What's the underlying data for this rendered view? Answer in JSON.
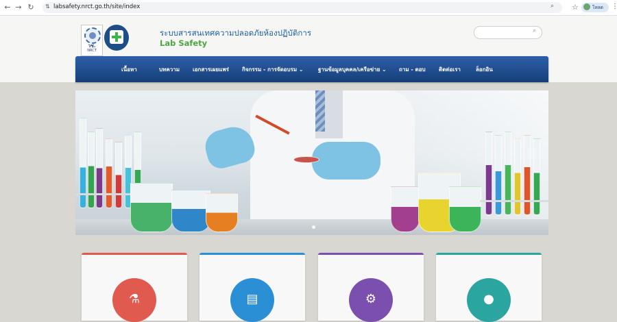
{
  "browser": {
    "url": "labsafety.nrct.go.th/site/index",
    "profile_label": "โหลด"
  },
  "header": {
    "title": "ระบบสารสนเทศความปลอดภัยห้องปฏิบัติการ",
    "subtitle": "Lab Safety",
    "logo1_text": "วช.",
    "logo1_sub": "NRCT"
  },
  "nav": {
    "items": [
      {
        "label": "เนื้อหา"
      },
      {
        "label": "บทความ"
      },
      {
        "label": "เอกสารเผยแพร่"
      },
      {
        "label": "กิจกรรม - การจัดอบรม ⌄"
      },
      {
        "label": "ฐานข้อมูลบุคคล/เครือข่าย ⌄"
      },
      {
        "label": "ถาม - ตอบ"
      },
      {
        "label": "ติดต่อเรา"
      },
      {
        "label": "ล็อกอิน"
      }
    ]
  },
  "cards": [
    {
      "icon": "flask-icon",
      "color": "#e05a4f"
    },
    {
      "icon": "book-icon",
      "color": "#2b8fd6"
    },
    {
      "icon": "gears-icon",
      "color": "#7b4fae"
    },
    {
      "icon": "user-icon",
      "color": "#2aa5a0"
    }
  ],
  "colors": {
    "nav_bg": "#1f4f93",
    "title": "#1d5f9e",
    "subtitle": "#4da63f",
    "card1": "#e05a4f",
    "card2": "#2b8fd6",
    "card3": "#7b4fae",
    "card4": "#2aa5a0"
  }
}
